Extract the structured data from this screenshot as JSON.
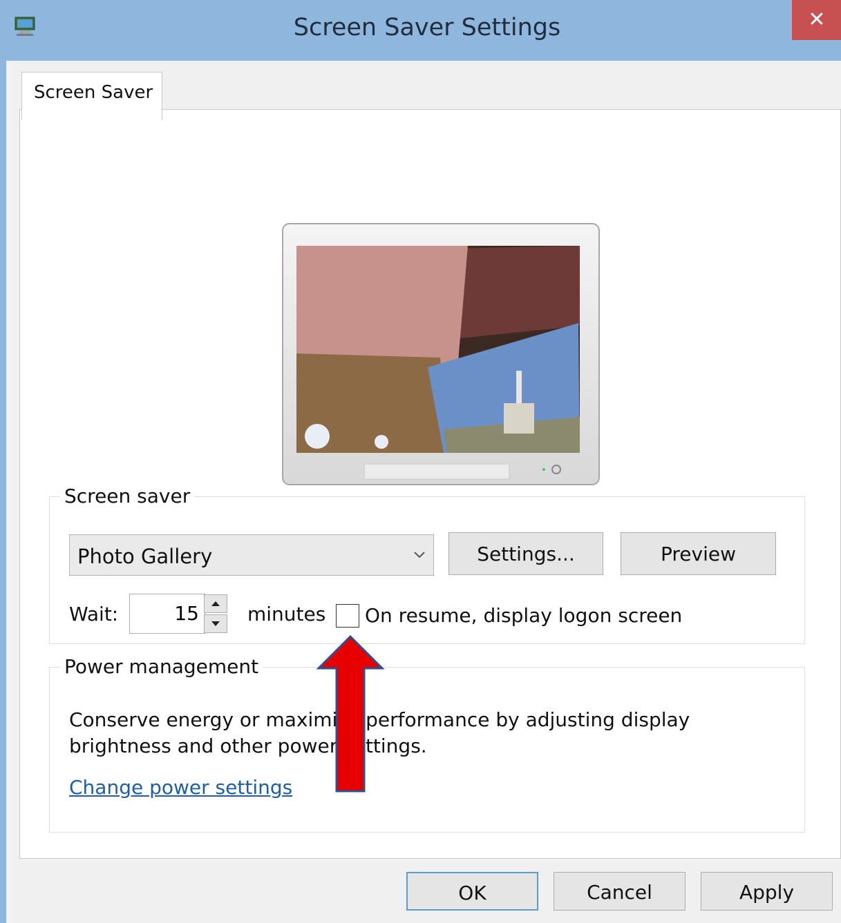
{
  "window": {
    "title": "Screen Saver Settings",
    "close_icon": "close-icon",
    "app_icon": "display-settings-icon"
  },
  "tabs": [
    {
      "label": "Screen Saver",
      "selected": true
    }
  ],
  "screen_saver_group": {
    "label": "Screen saver",
    "selected_saver": "Photo Gallery",
    "settings_button": "Settings...",
    "preview_button": "Preview",
    "wait_label": "Wait:",
    "wait_value": "15",
    "minutes_label": "minutes",
    "resume_checkbox_label": "On resume, display logon screen",
    "resume_checked": false
  },
  "power_group": {
    "label": "Power management",
    "description": "Conserve energy or maximize performance by adjusting display brightness and other power settings.",
    "link": "Change power settings"
  },
  "footer": {
    "ok": "OK",
    "cancel": "Cancel",
    "apply": "Apply"
  },
  "colors": {
    "titlebar": "#8fb6dc",
    "close": "#c75050",
    "link": "#1e5ea8",
    "annotation_arrow": "#e60000"
  }
}
